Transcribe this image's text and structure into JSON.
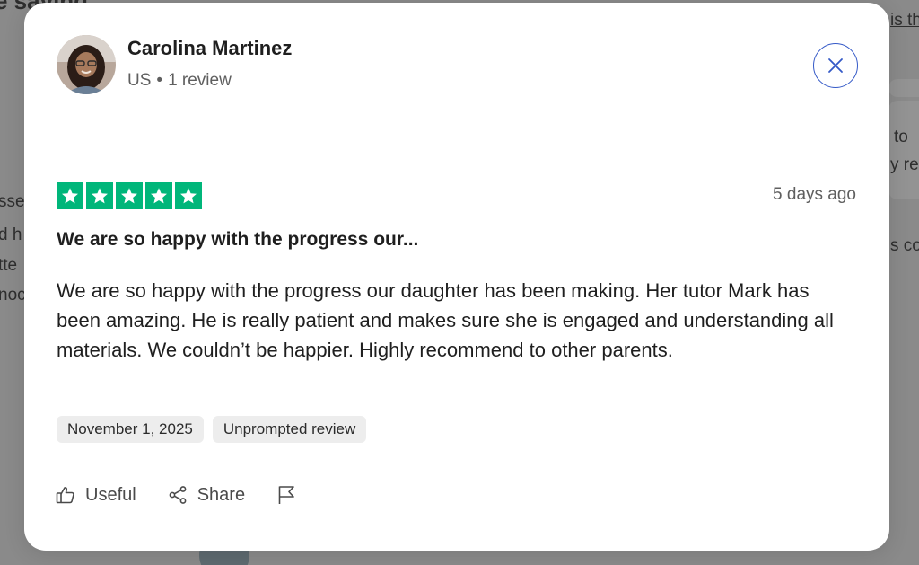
{
  "background": {
    "fragments": [
      "e saving",
      "is th",
      "to ",
      "y re",
      "s co",
      "sse",
      "d h",
      "tte",
      "noc"
    ]
  },
  "reviewer": {
    "name": "Carolina Martinez",
    "country": "US",
    "separator": "•",
    "review_count": "1 review"
  },
  "review": {
    "rating": 5,
    "rating_color": "#00b67a",
    "date_relative": "5 days ago",
    "title": "We are so happy with the progress our...",
    "text": "We are so happy with the progress our daughter has been making. Her tutor Mark has been amazing. He is really patient and makes sure she is engaged and understanding all materials. We couldn’t be happier. Highly recommend to other parents.",
    "tags": {
      "date": "November 1, 2025",
      "type": "Unprompted review"
    }
  },
  "actions": {
    "useful_label": "Useful",
    "share_label": "Share"
  },
  "icons": {
    "close": "close-icon",
    "useful": "thumbs-up-icon",
    "share": "share-icon",
    "report": "flag-icon",
    "star": "star-icon"
  },
  "colors": {
    "accent": "#3459c7",
    "star_green": "#00b67a"
  }
}
